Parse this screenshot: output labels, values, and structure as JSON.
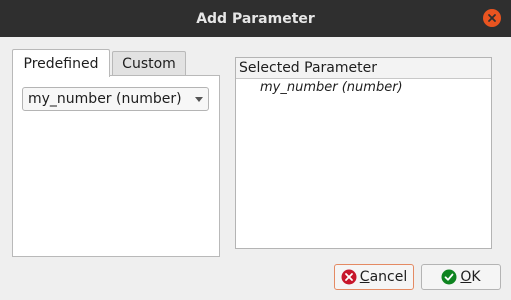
{
  "window": {
    "title": "Add Parameter"
  },
  "tabs": [
    {
      "label": "Predefined",
      "active": true
    },
    {
      "label": "Custom",
      "active": false
    }
  ],
  "predefined": {
    "selected_value": "my_number (number)"
  },
  "selected_list": {
    "header": "Selected Parameter",
    "items": [
      "my_number (number)"
    ]
  },
  "buttons": {
    "cancel_mnemonic": "C",
    "cancel_rest": "ancel",
    "ok_mnemonic": "O",
    "ok_rest": "K"
  },
  "colors": {
    "titlebar": "#2f2f2f",
    "close_button": "#e95420",
    "cancel_icon": "#c7162b",
    "ok_icon": "#0e8420"
  },
  "icons": {
    "close": "close-icon",
    "cancel": "cancel-icon",
    "ok": "ok-check-icon",
    "dropdown": "chevron-down-icon"
  }
}
